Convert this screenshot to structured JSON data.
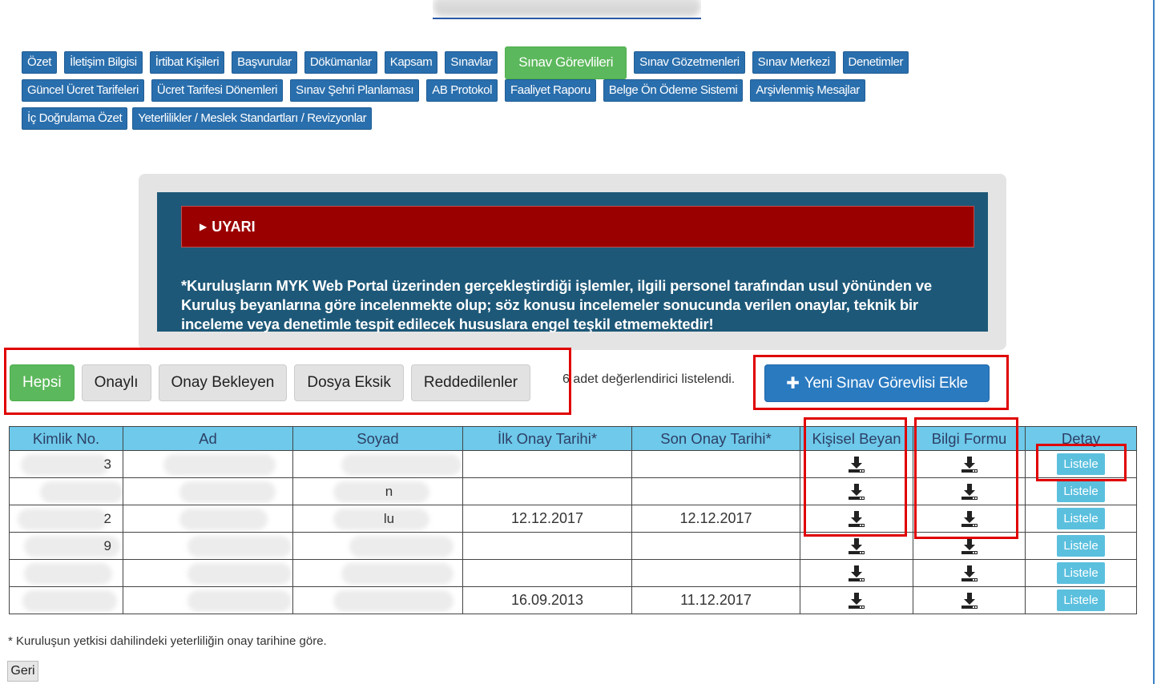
{
  "tabs": {
    "row1": [
      {
        "label": "Özet",
        "active": false
      },
      {
        "label": "İletişim Bilgisi",
        "active": false
      },
      {
        "label": "İrtibat Kişileri",
        "active": false
      },
      {
        "label": "Başvurular",
        "active": false
      },
      {
        "label": "Dökümanlar",
        "active": false
      },
      {
        "label": "Kapsam",
        "active": false
      },
      {
        "label": "Sınavlar",
        "active": false
      },
      {
        "label": "Sınav Görevlileri",
        "active": true
      },
      {
        "label": "Sınav Gözetmenleri",
        "active": false
      },
      {
        "label": "Sınav Merkezi",
        "active": false
      },
      {
        "label": "Denetimler",
        "active": false
      }
    ],
    "row2": [
      {
        "label": "Güncel Ücret Tarifeleri"
      },
      {
        "label": "Ücret Tarifesi Dönemleri"
      },
      {
        "label": "Sınav Şehri Planlaması"
      },
      {
        "label": "AB Protokol"
      },
      {
        "label": "Faaliyet Raporu"
      },
      {
        "label": "Belge Ön Ödeme Sistemi"
      },
      {
        "label": "Arşivlenmiş Mesajlar"
      }
    ],
    "row3": [
      {
        "label": "İç Doğrulama Özet"
      },
      {
        "label": "Yeterlilikler / Meslek Standartları / Revizyonlar"
      }
    ]
  },
  "warning": {
    "title": "UYARI",
    "text": "*Kuruluşların MYK Web Portal üzerinden gerçekleştirdiği işlemler, ilgili personel tarafından usul yönünden ve Kuruluş beyanlarına göre incelenmekte olup; söz konusu incelemeler sonucunda verilen onaylar, teknik bir inceleme veya denetimle tespit edilecek hususlara engel teşkil etmemektedir!"
  },
  "filters": {
    "all": "Hepsi",
    "approved": "Onaylı",
    "pending": "Onay Bekleyen",
    "missing_docs": "Dosya Eksik",
    "rejected": "Reddedilenler",
    "active": "all"
  },
  "count_text": "6 adet değerlendirici listelendi.",
  "add_button": "Yeni Sınav Görevlisi Ekle",
  "table": {
    "headers": {
      "id_no": "Kimlik No.",
      "first_name": "Ad",
      "last_name": "Soyad",
      "first_approval": "İlk Onay Tarihi*",
      "last_approval": "Son Onay Tarihi*",
      "personal_statement": "Kişisel Beyan",
      "info_form": "Bilgi Formu",
      "detail": "Detay"
    },
    "rows": [
      {
        "id_no": "3",
        "first_name": "",
        "last_name": "",
        "first_approval": "",
        "last_approval": "",
        "detail": "Listele"
      },
      {
        "id_no": "",
        "first_name": "",
        "last_name": "n",
        "first_approval": "",
        "last_approval": "",
        "detail": "Listele"
      },
      {
        "id_no": "2",
        "first_name": "",
        "last_name": "lu",
        "first_approval": "12.12.2017",
        "last_approval": "12.12.2017",
        "detail": "Listele"
      },
      {
        "id_no": "9",
        "first_name": "",
        "last_name": "",
        "first_approval": "",
        "last_approval": "",
        "detail": "Listele"
      },
      {
        "id_no": "",
        "first_name": "",
        "last_name": "",
        "first_approval": "",
        "last_approval": "",
        "detail": "Listele"
      },
      {
        "id_no": "",
        "first_name": "",
        "last_name": "",
        "first_approval": "16.09.2013",
        "last_approval": "11.12.2017",
        "detail": "Listele"
      }
    ]
  },
  "footnote": "* Kuruluşun yetkisi dahilindeki yeterliliğin onay tarihine göre.",
  "back_button": "Geri",
  "colors": {
    "tab_blue": "#2a6fad",
    "active_green": "#5cb85c",
    "warning_red": "#9a0000",
    "warning_panel": "#1d5878",
    "table_header": "#6ec9ea",
    "list_button": "#5bc0de",
    "highlight_red": "#e00000"
  }
}
